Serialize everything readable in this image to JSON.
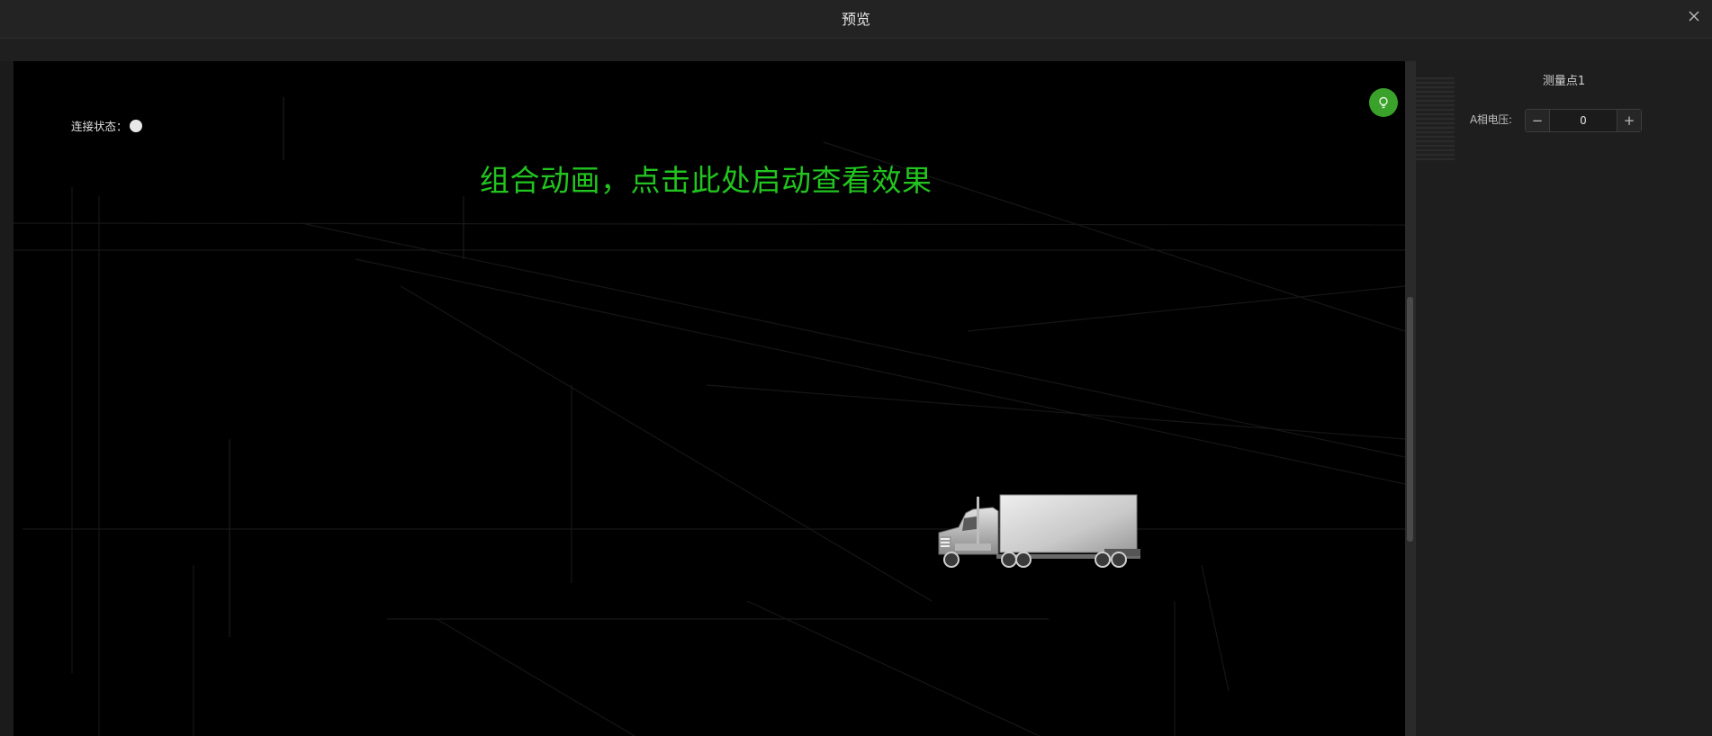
{
  "window": {
    "title": "预览"
  },
  "canvas": {
    "connection_label": "连接状态：",
    "animation_hint": "组合动画，点击此处启动查看效果"
  },
  "panel": {
    "measure_point_title": "测量点1",
    "field_label": "A相电压:",
    "field_value": "0",
    "minus_label": "−",
    "plus_label": "+"
  },
  "colors": {
    "hint_text": "#22c41f",
    "status_dot": "#e8e8e8",
    "floating_button": "#3aa12a"
  },
  "icons": {
    "close": "close-icon",
    "fab": "lightbulb-icon",
    "truck": "truck-image"
  }
}
